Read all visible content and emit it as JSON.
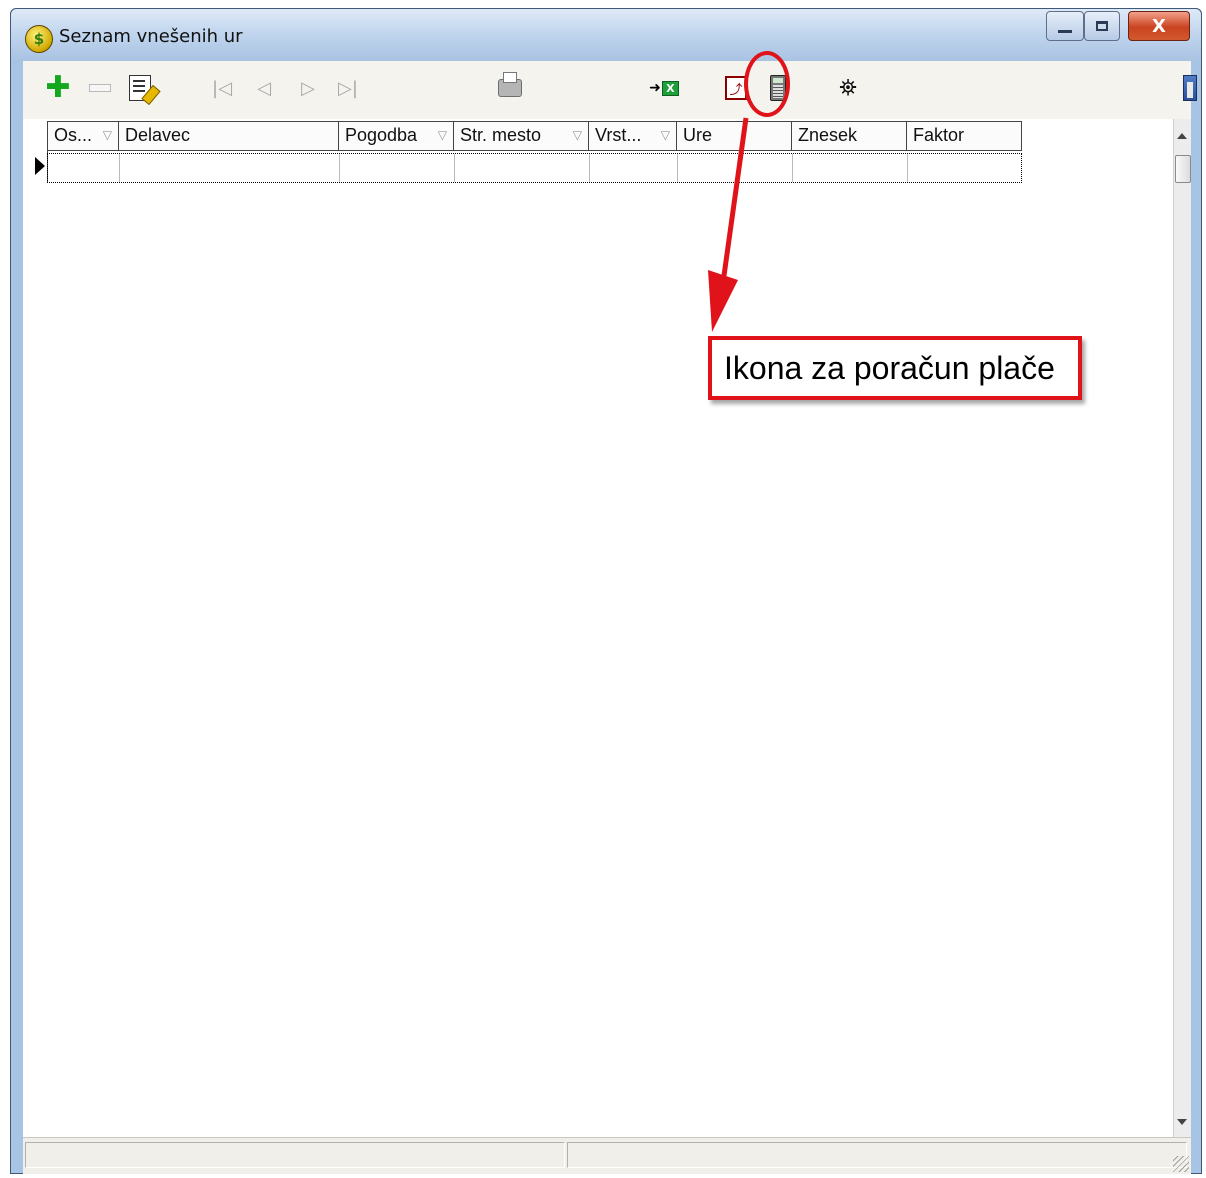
{
  "window": {
    "title": "Seznam vnešenih ur",
    "app_icon_glyph": "$",
    "close_glyph": "X"
  },
  "toolbar": {
    "icons": [
      "add-icon",
      "delete-icon",
      "edit-icon",
      "first-record-icon",
      "previous-record-icon",
      "next-record-icon",
      "last-record-icon",
      "print-icon",
      "excel-export-icon",
      "pdf-icon",
      "calculator-icon",
      "binoculars-icon",
      "exit-icon"
    ],
    "plus_glyph": "✚",
    "first_glyph": "|◁",
    "prev_glyph": "◁",
    "next_glyph": "▷",
    "last_glyph": "▷|",
    "excel_arrow_glyph": "➜",
    "excel_letter": "X",
    "binoculars_glyph": "⛯"
  },
  "grid": {
    "columns": [
      {
        "label": "Os...",
        "sortable": true
      },
      {
        "label": "Delavec",
        "sortable": false
      },
      {
        "label": "Pogodba",
        "sortable": true
      },
      {
        "label": "Str. mesto",
        "sortable": true
      },
      {
        "label": "Vrst...",
        "sortable": true
      },
      {
        "label": "Ure",
        "sortable": false
      },
      {
        "label": "Znesek",
        "sortable": false
      },
      {
        "label": "Faktor",
        "sortable": false
      }
    ],
    "sort_glyph": "▽",
    "rows": []
  },
  "annotation": {
    "callout_text": "Ikona za poračun plače",
    "color": "#e0131a"
  }
}
